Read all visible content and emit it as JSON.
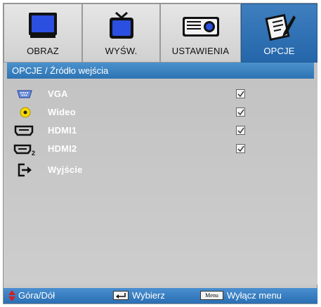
{
  "tabs": [
    {
      "label": "OBRAZ",
      "icon": "monitor-icon",
      "active": false
    },
    {
      "label": "WYŚW.",
      "icon": "tv-icon",
      "active": false
    },
    {
      "label": "USTAWIENIA",
      "icon": "projector-icon",
      "active": false
    },
    {
      "label": "OPCJE",
      "icon": "notepad-icon",
      "active": true
    }
  ],
  "panel": {
    "title": "OPCJE / Źródło wejścia",
    "items": [
      {
        "label": "VGA",
        "icon": "vga-port-icon",
        "checked": true
      },
      {
        "label": "Wideo",
        "icon": "video-rca-icon",
        "checked": true
      },
      {
        "label": "HDMI1",
        "icon": "hdmi-icon",
        "checked": true
      },
      {
        "label": "HDMI2",
        "icon": "hdmi2-icon",
        "checked": true
      },
      {
        "label": "Wyjście",
        "icon": "exit-icon",
        "checked": null
      }
    ]
  },
  "footer": {
    "navigate_label": "Góra/Dół",
    "select_label": "Wybierz",
    "menu_key": "Menu",
    "exit_label": "Wyłącz menu"
  },
  "colors": {
    "accent": "#2d73b3",
    "panel_bg": "#c6c6c6",
    "text_light": "#ffffff",
    "arrow_red": "#d42020"
  }
}
